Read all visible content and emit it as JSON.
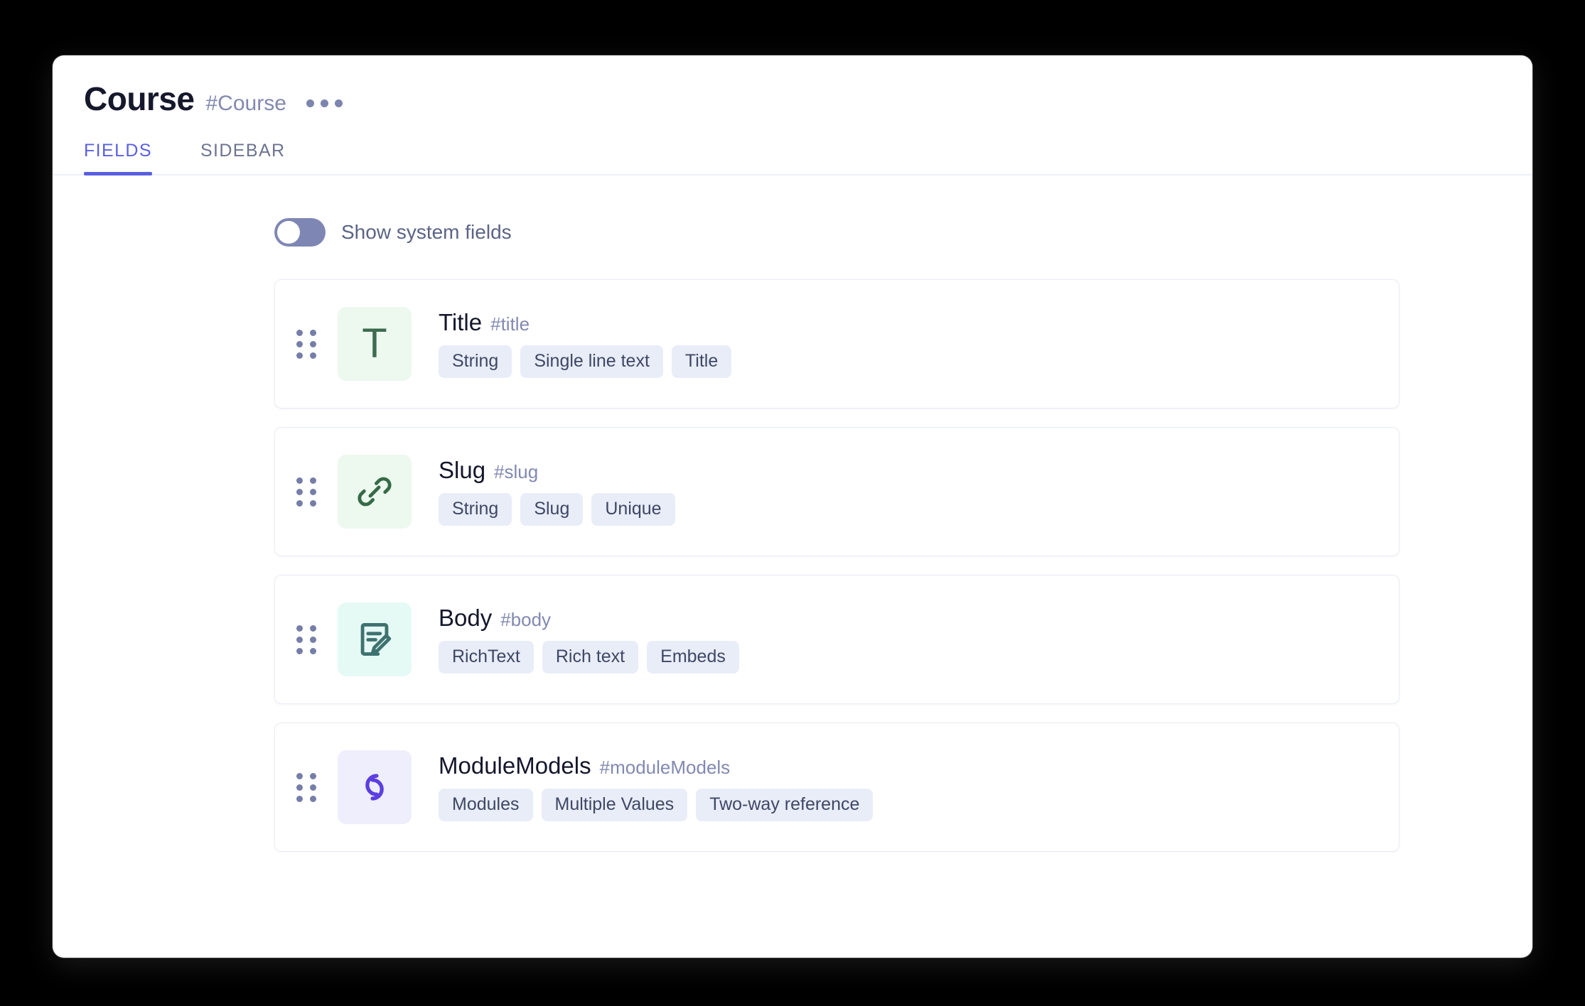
{
  "window": {
    "title": "Course",
    "title_hash": "#Course",
    "menu_icon": "kebab-menu-icon"
  },
  "tabs": [
    {
      "label": "FIELDS",
      "active": true
    },
    {
      "label": "SIDEBAR",
      "active": false
    }
  ],
  "controls": {
    "show_system_fields": {
      "label": "Show system fields",
      "state": "off"
    }
  },
  "colors": {
    "accent": "#5a5fe0",
    "tab_inactive": "#6d7490",
    "hash_text": "#8289b0",
    "tag_bg": "#e9edf8",
    "tag_text": "#3f4765",
    "toggle_track": "#7e87b4",
    "drag_dot": "#757ea8",
    "page_bg": "#000000",
    "card_bg": "#ffffff"
  },
  "fields": [
    {
      "name": "Title",
      "hash": "#title",
      "icon": "text-field-icon",
      "icon_glyph": "T",
      "icon_bg": "#edf8ee",
      "icon_fg": "#3d6b50",
      "tags": [
        "String",
        "Single line text",
        "Title"
      ]
    },
    {
      "name": "Slug",
      "hash": "#slug",
      "icon": "link-icon",
      "icon_glyph": "link",
      "icon_bg": "#edf8ee",
      "icon_fg": "#356b47",
      "tags": [
        "String",
        "Slug",
        "Unique"
      ]
    },
    {
      "name": "Body",
      "hash": "#body",
      "icon": "rich-text-document-edit-icon",
      "icon_glyph": "doc-pencil",
      "icon_bg": "#e6faf5",
      "icon_fg": "#3e7270",
      "tags": [
        "RichText",
        "Rich text",
        "Embeds"
      ]
    },
    {
      "name": "ModuleModels",
      "hash": "#moduleModels",
      "icon": "two-way-reference-icon",
      "icon_glyph": "rings",
      "icon_bg": "#efeefc",
      "icon_fg": "#5b3fe0",
      "tags": [
        "Modules",
        "Multiple Values",
        "Two-way reference"
      ]
    }
  ]
}
